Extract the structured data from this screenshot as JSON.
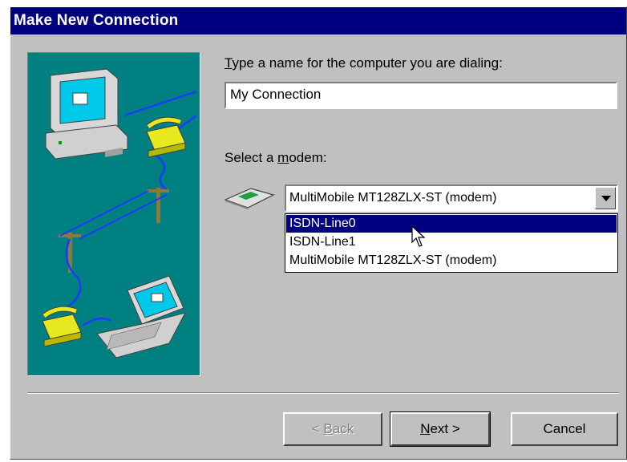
{
  "window": {
    "title": "Make New Connection"
  },
  "name_field": {
    "label_prefix": "",
    "label_mnemonic": "T",
    "label_rest": "ype a name for the computer you are dialing:",
    "value": "My Connection"
  },
  "modem": {
    "label_prefix": "Select a ",
    "label_mnemonic": "m",
    "label_rest": "odem:",
    "selected": "MultiMobile MT128ZLX-ST (modem)",
    "options": [
      {
        "label": "ISDN-Line0",
        "highlighted": true
      },
      {
        "label": "ISDN-Line1",
        "highlighted": false
      },
      {
        "label": "MultiMobile MT128ZLX-ST (modem)",
        "highlighted": false
      }
    ]
  },
  "buttons": {
    "back": {
      "prefix": "< ",
      "mnemonic": "B",
      "rest": "ack",
      "enabled": false
    },
    "next": {
      "prefix": "",
      "mnemonic": "N",
      "rest": "ext >",
      "enabled": true
    },
    "cancel": {
      "label": "Cancel",
      "enabled": true
    }
  },
  "colors": {
    "titlebar": "#000080",
    "face": "#c0c0c0",
    "illustration_bg": "#008080",
    "highlight": "#000080"
  },
  "icons": [
    "computer-icon",
    "telephone-icon",
    "laptop-icon",
    "modem-icon",
    "mouse-pointer-icon"
  ]
}
